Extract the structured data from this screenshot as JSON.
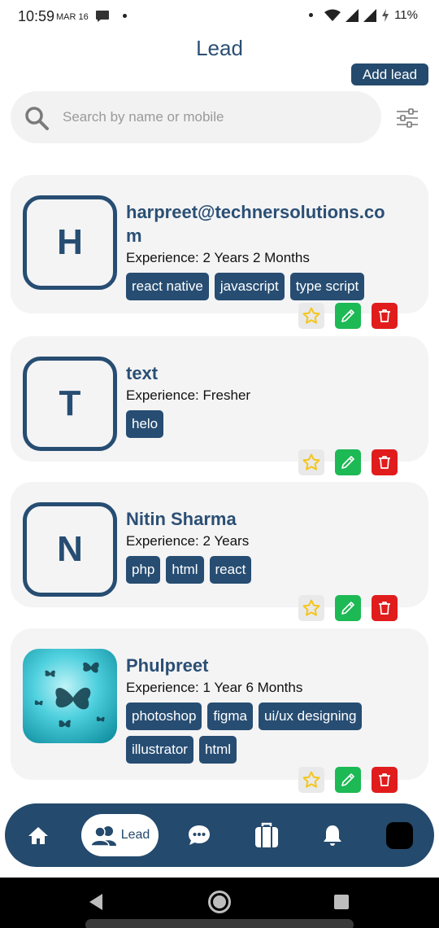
{
  "status_bar": {
    "time": "10:59",
    "date": "MAR 16",
    "battery": "11%"
  },
  "header": {
    "title": "Lead",
    "add_button_label": "Add lead"
  },
  "search": {
    "placeholder": "Search by name or mobile",
    "value": ""
  },
  "icons": {
    "search": "search-icon",
    "filter": "filter-sliders-icon",
    "favorite": "star-icon",
    "edit": "pencil-icon",
    "delete": "trash-icon"
  },
  "colors": {
    "primary": "#244a6d",
    "card_bg": "#f4f4f5",
    "edit": "#1db954",
    "delete": "#e11c1c",
    "star": "#f5c518"
  },
  "leads": [
    {
      "initial": "H",
      "name": "harpreet@technersolutions.com",
      "experience": "Experience: 2 Years 2 Months",
      "skills": [
        "react native",
        "javascript",
        "type script"
      ]
    },
    {
      "initial": "T",
      "name": "text",
      "experience": "Experience: Fresher",
      "skills": [
        "helo"
      ]
    },
    {
      "initial": "N",
      "name": "Nitin Sharma",
      "experience": "Experience: 2 Years",
      "skills": [
        "php",
        "html",
        "react"
      ]
    },
    {
      "initial": "",
      "has_photo": true,
      "name": "Phulpreet",
      "experience": "Experience: 1 Year 6 Months",
      "skills": [
        "photoshop",
        "figma",
        "ui/ux designing",
        "illustrator",
        "html"
      ]
    }
  ],
  "bottom_nav": {
    "items": [
      {
        "icon": "home-icon"
      },
      {
        "icon": "users-icon",
        "label": "Lead",
        "active": true
      },
      {
        "icon": "chat-icon"
      },
      {
        "icon": "briefcase-icon"
      },
      {
        "icon": "bell-icon"
      },
      {
        "icon": "profile-avatar"
      }
    ]
  }
}
